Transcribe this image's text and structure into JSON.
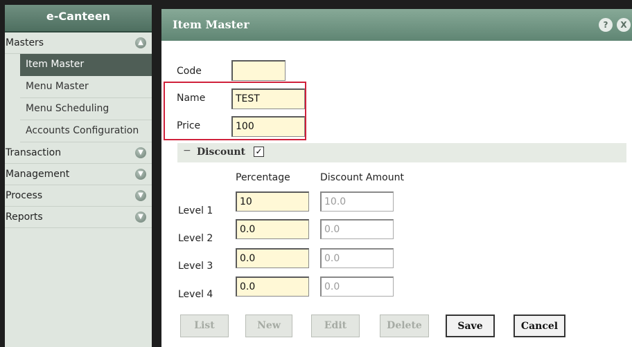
{
  "app_title": "e-Canteen",
  "sidebar": {
    "groups": [
      {
        "label": "Masters",
        "items": [
          "Item Master",
          "Menu Master",
          "Menu Scheduling",
          "Accounts Configuration"
        ],
        "active_item": "Item Master"
      },
      {
        "label": "Transaction"
      },
      {
        "label": "Management"
      },
      {
        "label": "Process"
      },
      {
        "label": "Reports"
      }
    ]
  },
  "panel": {
    "title": "Item Master",
    "help_label": "?",
    "close_label": "X"
  },
  "form": {
    "code_label": "Code",
    "code_value": "",
    "name_label": "Name",
    "name_value": "TEST",
    "price_label": "Price",
    "price_value": "100"
  },
  "discount": {
    "collapse_symbol": "−",
    "label": "Discount",
    "checked": true,
    "check_mark": "✓",
    "col_percentage": "Percentage",
    "col_amount": "Discount Amount",
    "levels": [
      {
        "label": "Level 1",
        "percentage": "10",
        "amount": "10.0"
      },
      {
        "label": "Level 2",
        "percentage": "0.0",
        "amount": "0.0"
      },
      {
        "label": "Level 3",
        "percentage": "0.0",
        "amount": "0.0"
      },
      {
        "label": "Level 4",
        "percentage": "0.0",
        "amount": "0.0"
      }
    ]
  },
  "buttons": {
    "list": "List",
    "new": "New",
    "edit": "Edit",
    "delete": "Delete",
    "save": "Save",
    "cancel": "Cancel"
  },
  "colors": {
    "accent": "#5f8573",
    "input_bg": "#fff8d6",
    "highlight": "#d0203a"
  },
  "icons": {
    "expand": "chevron-up-icon",
    "collapse": "chevron-down-icon"
  }
}
